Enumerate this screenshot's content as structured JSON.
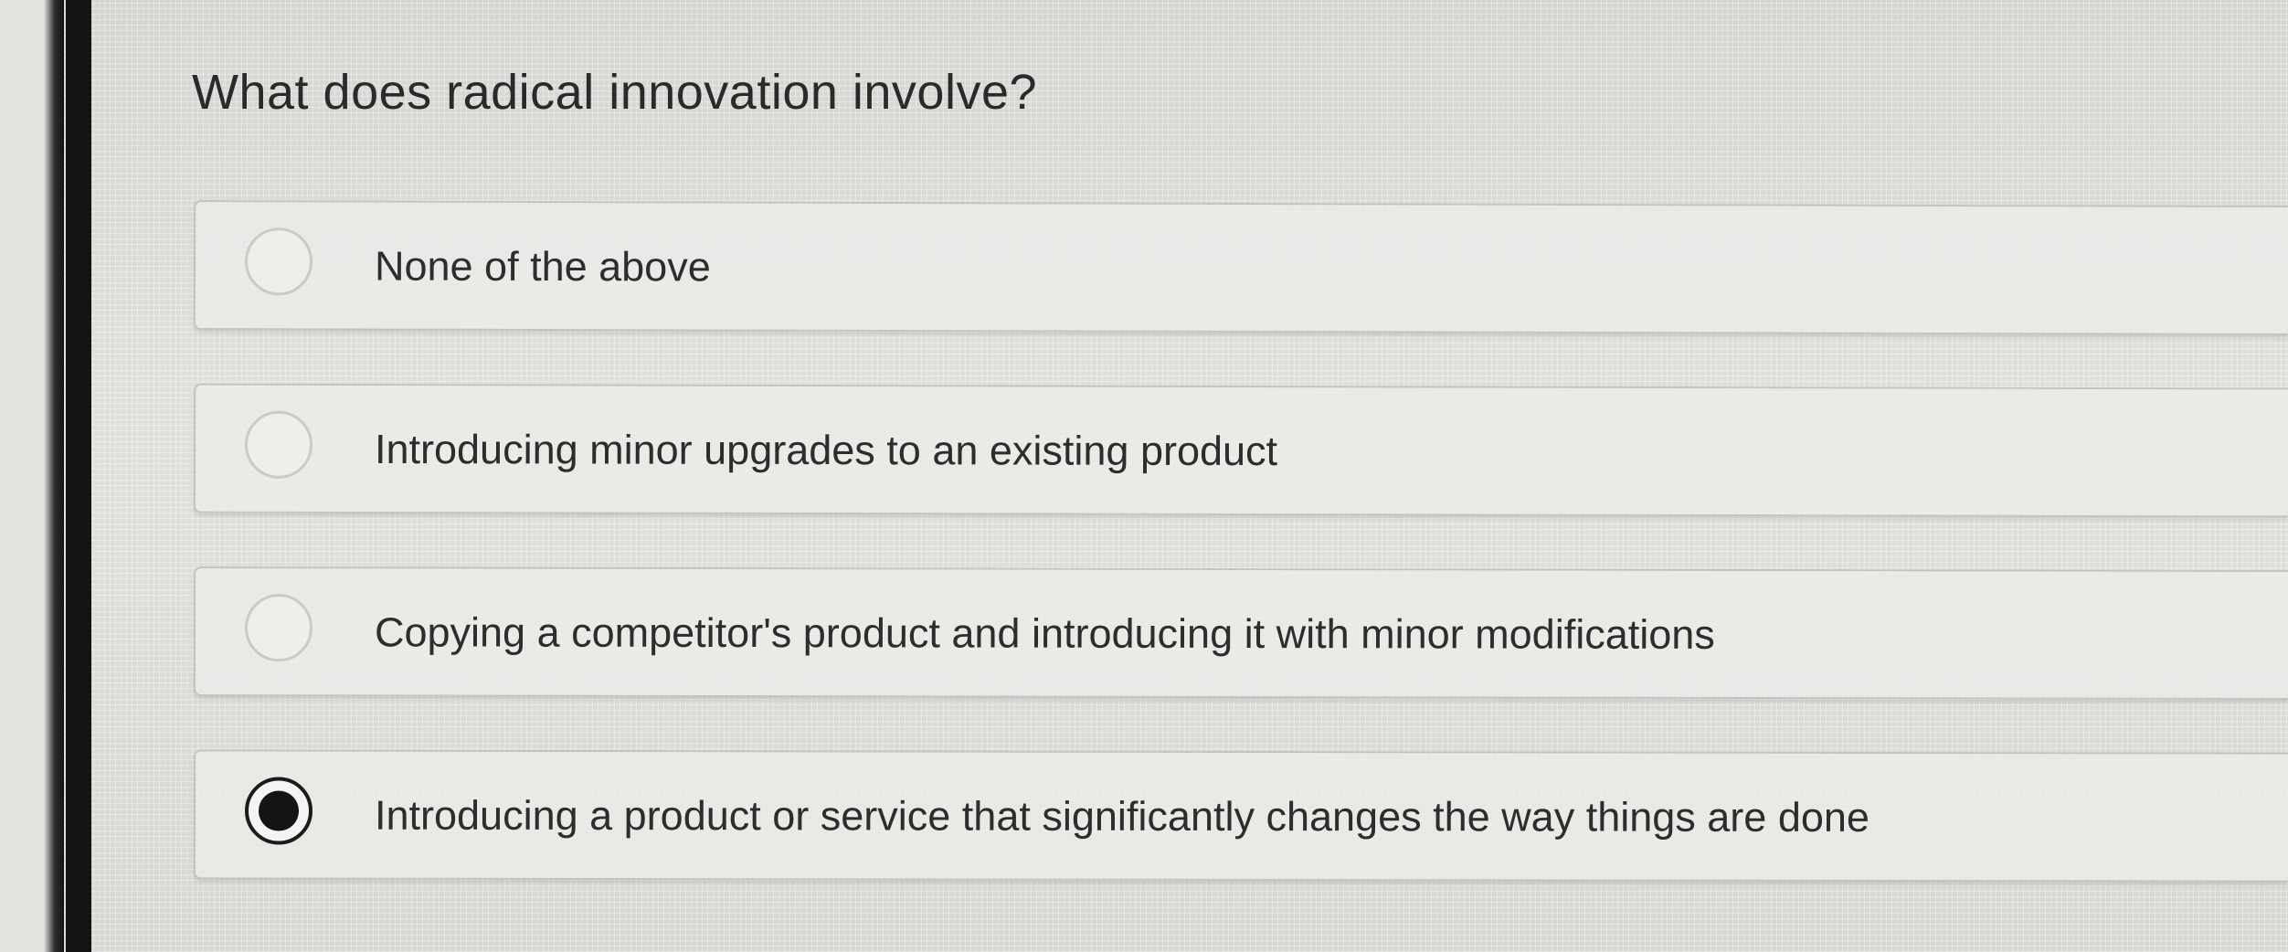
{
  "question": {
    "text": "What does radical innovation involve?"
  },
  "options": [
    {
      "label": "None of the above",
      "selected": false
    },
    {
      "label": "Introducing minor upgrades to an existing product",
      "selected": false
    },
    {
      "label": "Copying a competitor's product and introducing it with minor modifications",
      "selected": false
    },
    {
      "label": "Introducing a product or service that significantly changes the way things are done",
      "selected": true
    }
  ],
  "colors": {
    "selected_radio": "#141414",
    "text": "#2d2d2d",
    "option_background": "#ecede9"
  }
}
